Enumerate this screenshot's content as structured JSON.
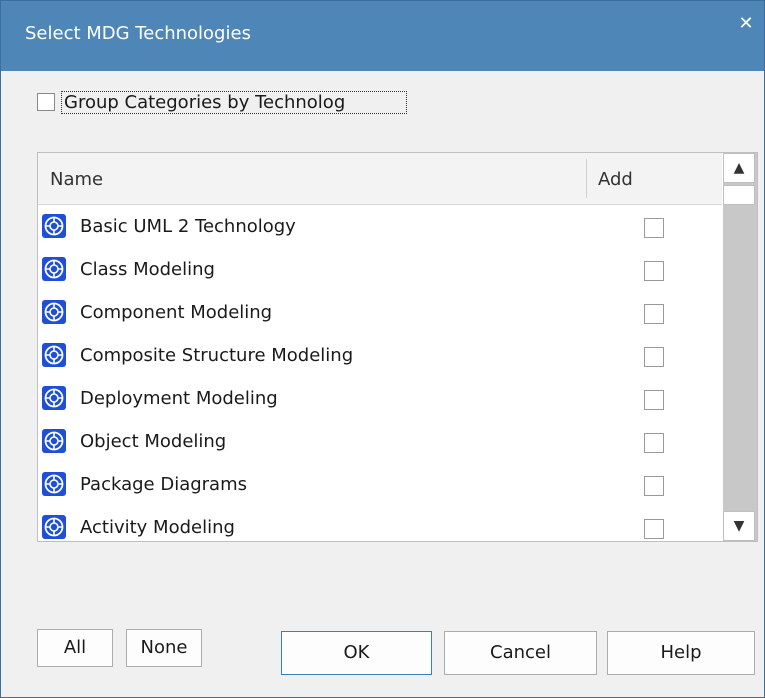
{
  "window": {
    "title": "Select MDG Technologies",
    "close_glyph": "✕"
  },
  "group_option": {
    "label": "Group Categories by Technolog",
    "checked": false
  },
  "list": {
    "columns": {
      "name": "Name",
      "add": "Add"
    },
    "rows": [
      {
        "icon": "mdg-technology-icon",
        "name": "Basic UML 2 Technology",
        "add": false
      },
      {
        "icon": "mdg-technology-icon",
        "name": "Class Modeling",
        "add": false
      },
      {
        "icon": "mdg-technology-icon",
        "name": "Component Modeling",
        "add": false
      },
      {
        "icon": "mdg-technology-icon",
        "name": "Composite Structure Modeling",
        "add": false
      },
      {
        "icon": "mdg-technology-icon",
        "name": "Deployment Modeling",
        "add": false
      },
      {
        "icon": "mdg-technology-icon",
        "name": "Object Modeling",
        "add": false
      },
      {
        "icon": "mdg-technology-icon",
        "name": "Package Diagrams",
        "add": false
      },
      {
        "icon": "mdg-technology-icon",
        "name": "Activity Modeling",
        "add": false
      }
    ],
    "scroll": {
      "up_glyph": "▲",
      "down_glyph": "▼"
    }
  },
  "buttons": {
    "all": "All",
    "none": "None",
    "ok": "OK",
    "cancel": "Cancel",
    "help": "Help"
  },
  "colors": {
    "titlebar": "#4e87b7",
    "icon_blue": "#1e4fd6"
  }
}
